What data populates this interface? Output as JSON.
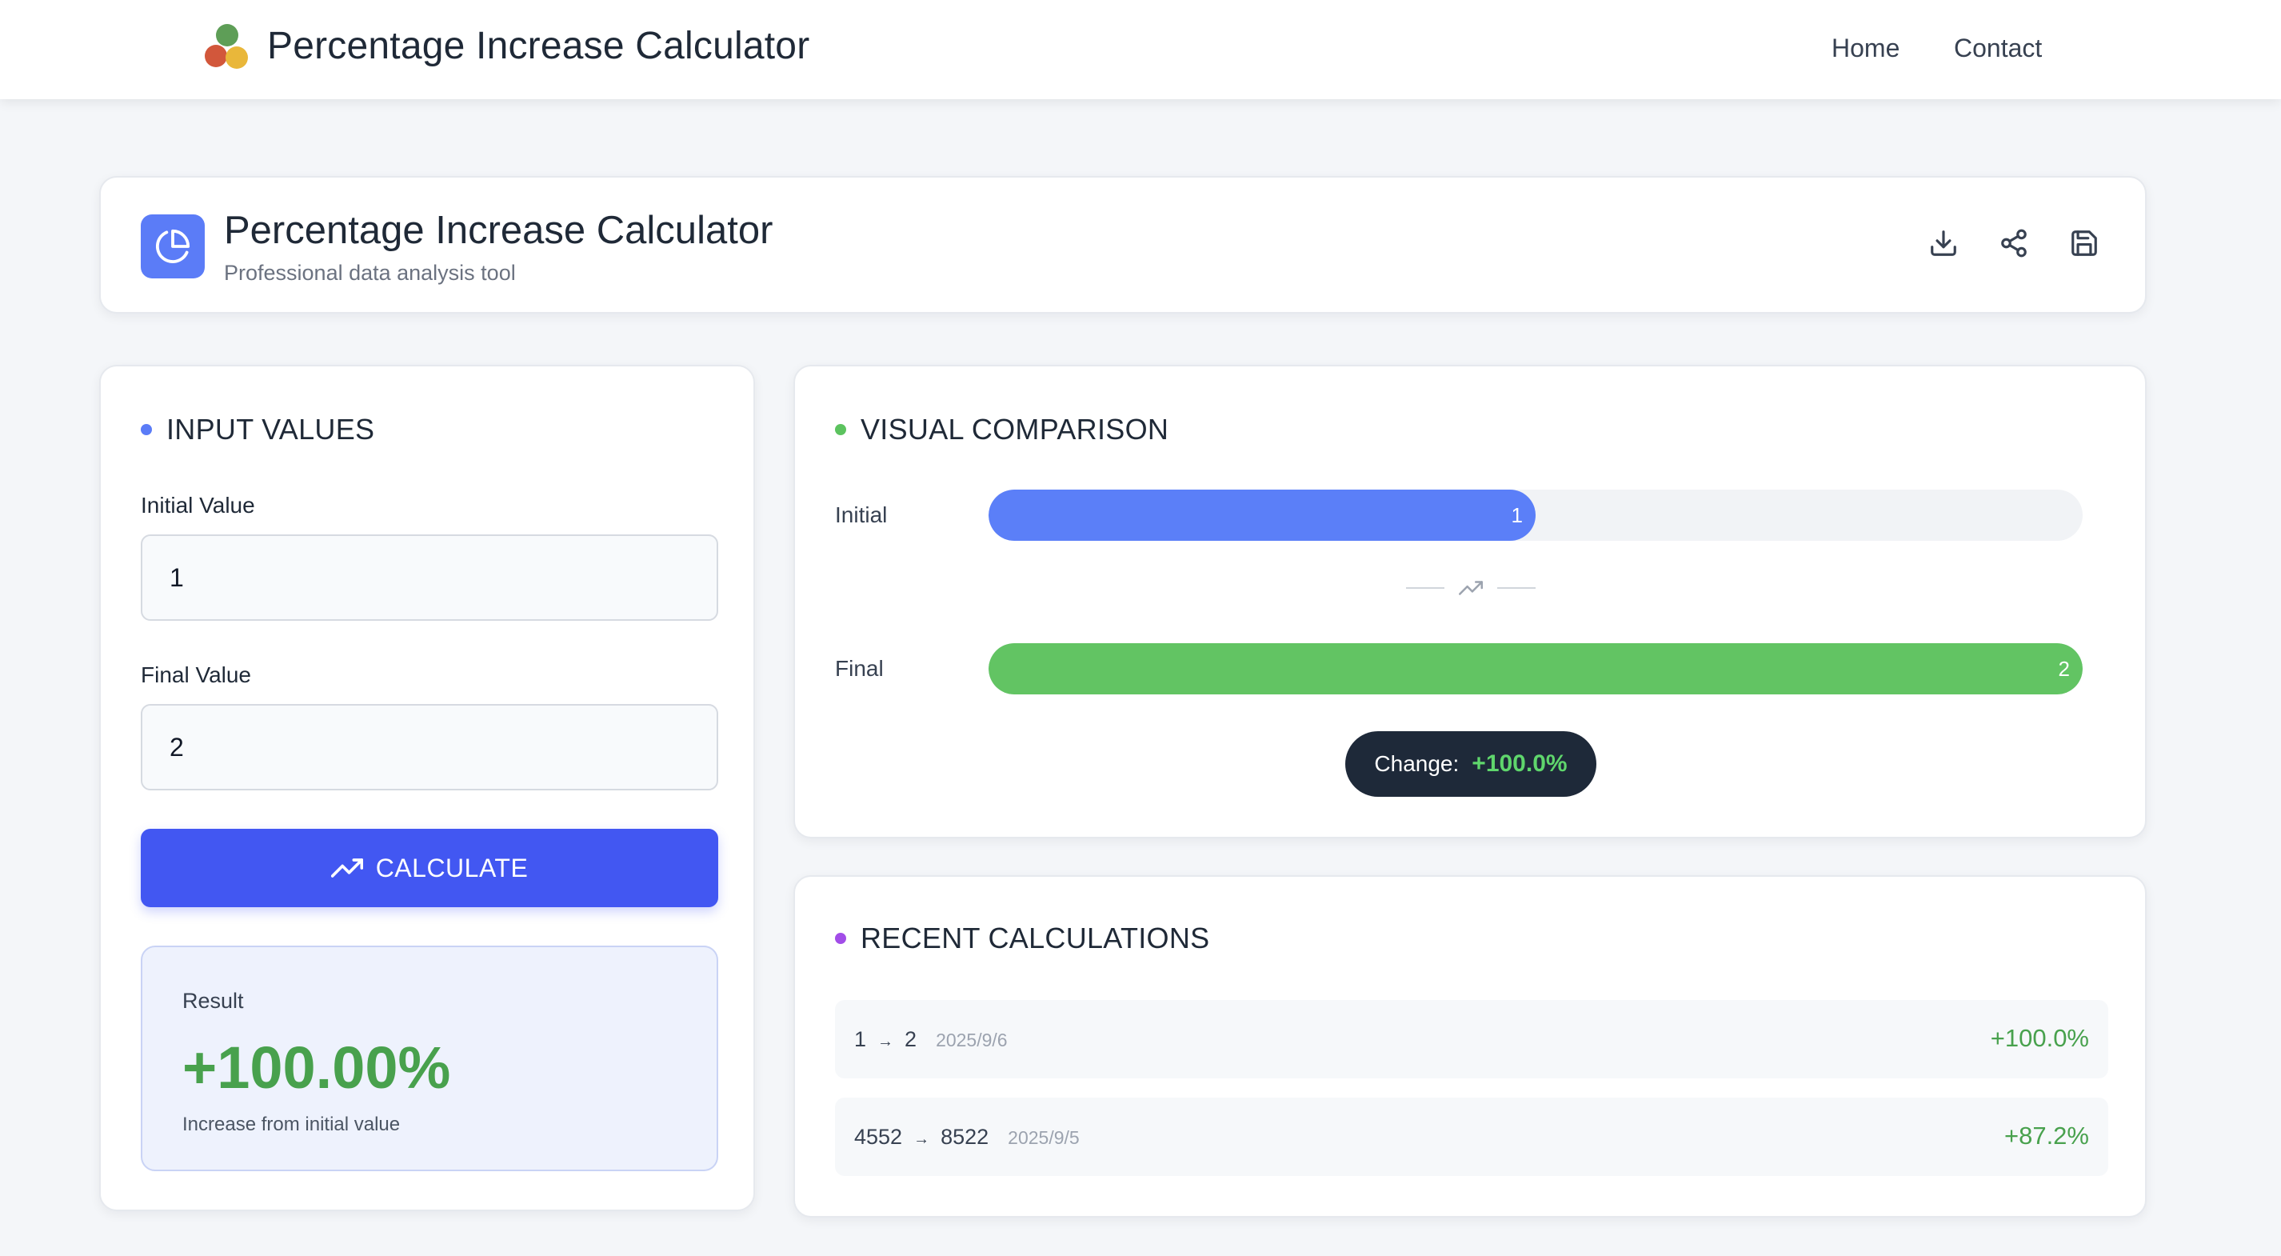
{
  "navbar": {
    "brand_title": "Percentage Increase Calculator",
    "links": {
      "home": "Home",
      "contact": "Contact"
    }
  },
  "header": {
    "title": "Percentage Increase Calculator",
    "subtitle": "Professional data analysis tool",
    "actions": [
      "download-icon",
      "share-icon",
      "save-icon"
    ]
  },
  "inputs": {
    "section_title": "INPUT VALUES",
    "initial_label": "Initial Value",
    "initial_value": "1",
    "final_label": "Final Value",
    "final_value": "2",
    "calculate_label": "CALCULATE"
  },
  "result": {
    "label": "Result",
    "value": "+100.00%",
    "description": "Increase from initial value"
  },
  "visual": {
    "section_title": "VISUAL COMPARISON",
    "initial_label": "Initial",
    "initial_bar_value": "1",
    "initial_fill_fraction": 0.5,
    "final_label": "Final",
    "final_bar_value": "2",
    "final_fill_fraction": 1.0,
    "change_label": "Change:",
    "change_value": "+100.0%"
  },
  "recent": {
    "section_title": "RECENT CALCULATIONS",
    "items": [
      {
        "from": "1",
        "to": "2",
        "date": "2025/9/6",
        "change": "+100.0%"
      },
      {
        "from": "4552",
        "to": "8522",
        "date": "2025/9/5",
        "change": "+87.2%"
      }
    ]
  },
  "colors": {
    "primary": "#4257f2",
    "input_bullet": "#5b7cf7",
    "visual_bullet": "#5cc35f",
    "recent_bullet": "#a24de8",
    "positive": "#48a14d",
    "initial_bar": "#5b7ff8",
    "final_bar": "#62c463"
  }
}
